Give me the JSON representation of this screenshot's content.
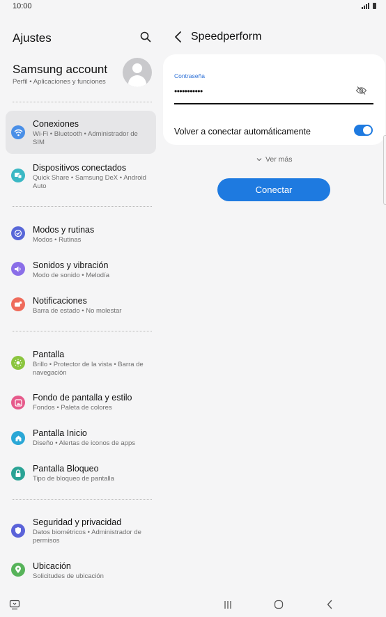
{
  "status_bar": {
    "time": "10:00"
  },
  "settings": {
    "title": "Ajustes",
    "account": {
      "name": "Samsung account",
      "subtitle": "Perfil  •  Aplicaciones y funciones"
    },
    "items": [
      {
        "title": "Conexiones",
        "subtitle": "Wi-Fi  •  Bluetooth  •  Administrador de SIM",
        "icon": "wifi-icon",
        "color": "#4a8fe7",
        "active": true
      },
      {
        "title": "Dispositivos conectados",
        "subtitle": "Quick Share  •  Samsung DeX  •  Android Auto",
        "icon": "devices-icon",
        "color": "#3bb8c4"
      },
      {
        "title": "Modos y rutinas",
        "subtitle": "Modos  •  Rutinas",
        "icon": "check-circle-icon",
        "color": "#5867d8"
      },
      {
        "title": "Sonidos y vibración",
        "subtitle": "Modo de sonido  •  Melodía",
        "icon": "speaker-icon",
        "color": "#8a6ee8"
      },
      {
        "title": "Notificaciones",
        "subtitle": "Barra de estado  •  No molestar",
        "icon": "notification-icon",
        "color": "#ef6b5b"
      },
      {
        "title": "Pantalla",
        "subtitle": "Brillo  •  Protector de la vista  •  Barra de navegación",
        "icon": "sun-icon",
        "color": "#8bc53f"
      },
      {
        "title": "Fondo de pantalla y estilo",
        "subtitle": "Fondos  •  Paleta de colores",
        "icon": "image-icon",
        "color": "#e65a8b"
      },
      {
        "title": "Pantalla Inicio",
        "subtitle": "Diseño  •  Alertas de iconos de apps",
        "icon": "home-icon",
        "color": "#2aa7d6"
      },
      {
        "title": "Pantalla Bloqueo",
        "subtitle": "Tipo de bloqueo de pantalla",
        "icon": "lock-icon",
        "color": "#2aa395"
      },
      {
        "title": "Seguridad y privacidad",
        "subtitle": "Datos biométricos  •  Administrador de permisos",
        "icon": "shield-icon",
        "color": "#5b63d9"
      },
      {
        "title": "Ubicación",
        "subtitle": "Solicitudes de ubicación",
        "icon": "location-icon",
        "color": "#57b35a"
      }
    ]
  },
  "network": {
    "title": "Speedperform",
    "password_label": "Contraseña",
    "password_value": "•••••••••••",
    "reconnect_label": "Volver a conectar automáticamente",
    "reconnect_on": true,
    "see_more": "Ver más",
    "connect_button": "Conectar"
  },
  "colors": {
    "accent": "#1e7ae0",
    "background": "#f5f5f6",
    "card": "#ffffff"
  }
}
